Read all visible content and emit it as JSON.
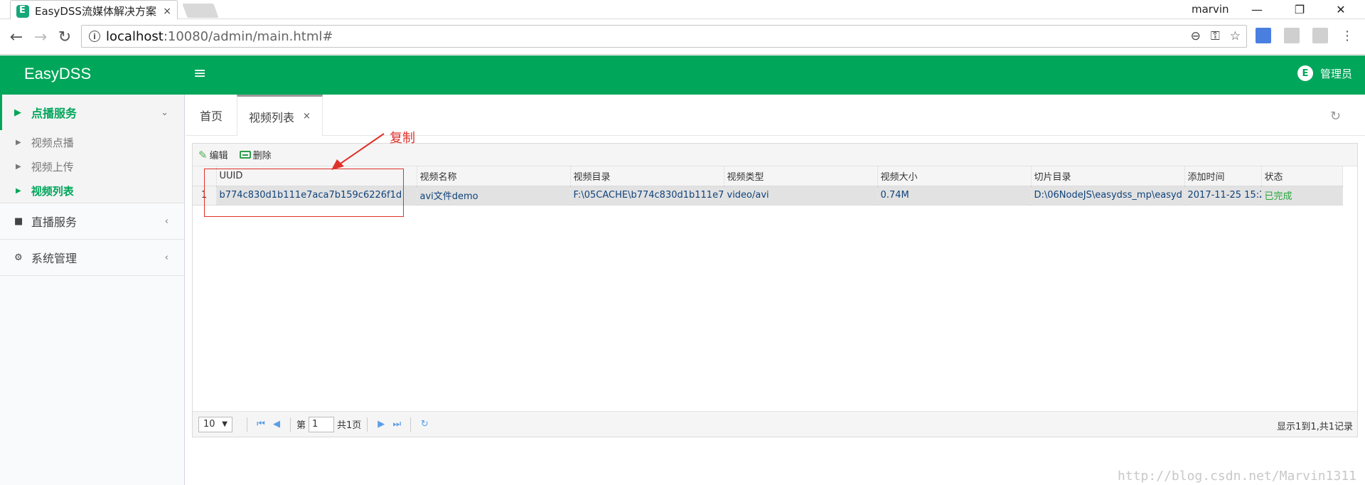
{
  "browser": {
    "tab_title": "EasyDSS流媒体解决方案",
    "tab_close": "×",
    "profile": "marvin",
    "url_host": "localhost",
    "url_rest": ":10080/admin/main.html#",
    "win_min": "—",
    "win_restore": "❐",
    "win_close": "✕"
  },
  "app": {
    "logo": "EasyDSS",
    "admin_label": "管理员"
  },
  "sidebar": {
    "groups": [
      {
        "label": "点播服务",
        "items": [
          {
            "label": "视频点播"
          },
          {
            "label": "视频上传"
          },
          {
            "label": "视频列表"
          }
        ]
      },
      {
        "label": "直播服务"
      },
      {
        "label": "系统管理"
      }
    ]
  },
  "tabs": [
    {
      "label": "首页"
    },
    {
      "label": "视频列表",
      "close": "×"
    }
  ],
  "toolbar": {
    "edit_label": "编辑",
    "delete_label": "删除"
  },
  "grid": {
    "columns": [
      "UUID",
      "视频名称",
      "视频目录",
      "视频类型",
      "视频大小",
      "切片目录",
      "添加时间",
      "状态"
    ],
    "rows": [
      {
        "rownum": "1",
        "uuid": "b774c830d1b111e7aca7b159c6226f1d",
        "name": "avi文件demo",
        "dir": "F:\\05CACHE\\b774c830d1b111e7",
        "type": "video/avi",
        "size": "0.74M",
        "slice_dir": "D:\\06NodeJS\\easydss_mp\\easyd",
        "added": "2017-11-25 15:2",
        "status": "已完成"
      }
    ]
  },
  "pager": {
    "page_size": "10",
    "page_prefix": "第",
    "page_value": "1",
    "page_total": "共1页",
    "info": "显示1到1,共1记录"
  },
  "annotation": {
    "label": "复制"
  },
  "watermark": "http://blog.csdn.net/Marvin1311"
}
